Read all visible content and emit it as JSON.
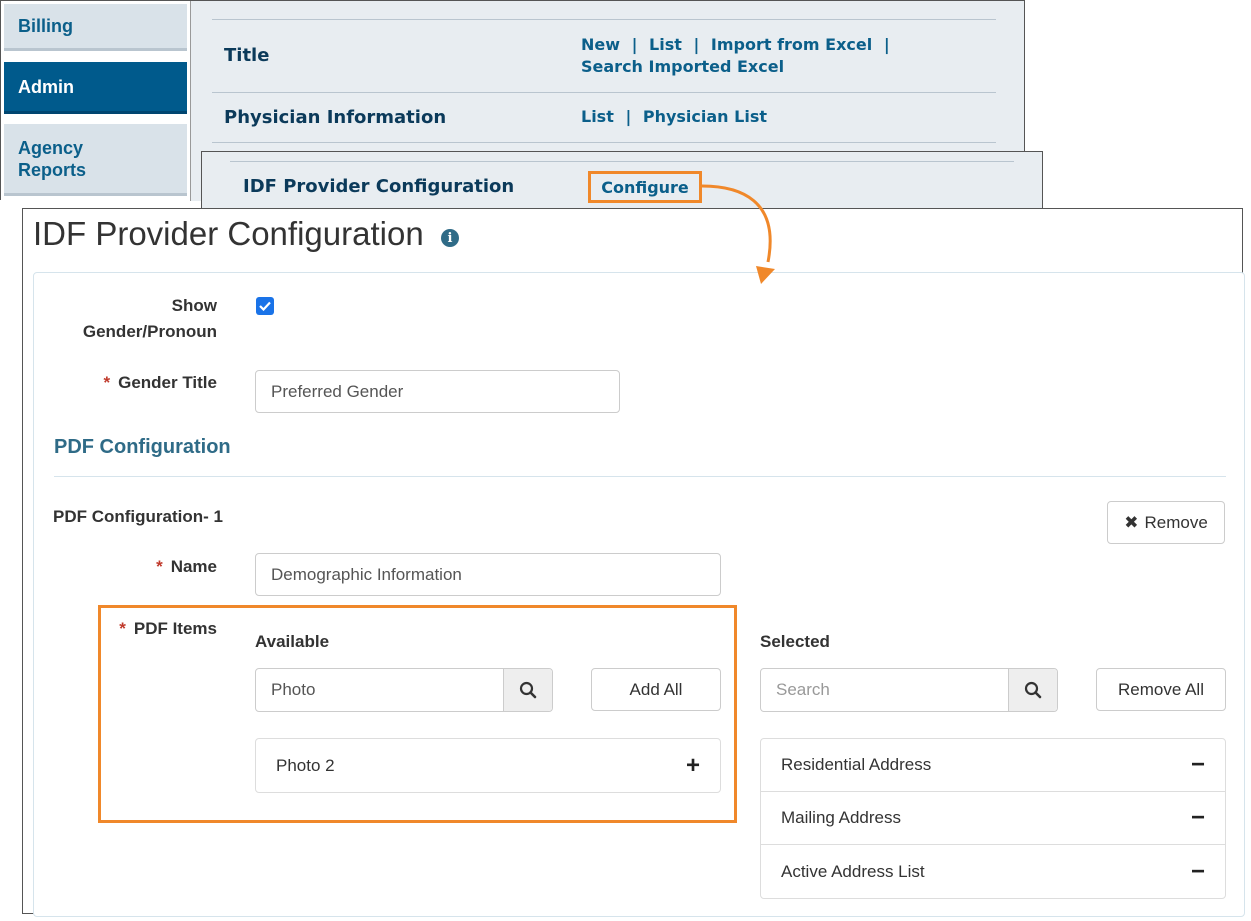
{
  "colors": {
    "accent_orange": "#f0882a",
    "link_blue": "#0b5f8a",
    "admin_active": "#005a8c",
    "section_title": "#2f6b87"
  },
  "side_nav": {
    "items": [
      {
        "label": "Billing"
      },
      {
        "label": "Admin",
        "active": true
      },
      {
        "label": "Agency Reports"
      }
    ]
  },
  "admin_menu": {
    "rows": [
      {
        "label": "Title",
        "links": [
          "New",
          "List",
          "Import from Excel",
          "Search Imported Excel"
        ]
      },
      {
        "label": "Physician Information",
        "links": [
          "List",
          "Physician List"
        ]
      },
      {
        "label": "IDF Provider Configuration",
        "links": [
          "Configure"
        ]
      }
    ],
    "separator": "|"
  },
  "config_page": {
    "title": "IDF Provider Configuration",
    "info_icon": "info-circle-icon",
    "show_gender_label": "Show Gender/Pronoun",
    "show_gender_checked": true,
    "gender_title_label": "Gender Title",
    "gender_title_value": "Preferred Gender",
    "required_mark": "*",
    "pdf_section_title": "PDF Configuration",
    "pdf_config": {
      "title": "PDF Configuration- 1",
      "remove_label": "Remove",
      "name_label": "Name",
      "name_value": "Demographic Information",
      "items_label": "PDF Items",
      "available": {
        "heading": "Available",
        "search_value": "Photo",
        "add_all_label": "Add All",
        "items": [
          "Photo 2"
        ]
      },
      "selected": {
        "heading": "Selected",
        "search_placeholder": "Search",
        "remove_all_label": "Remove All",
        "items": [
          "Residential Address",
          "Mailing Address",
          "Active Address List"
        ]
      }
    }
  }
}
